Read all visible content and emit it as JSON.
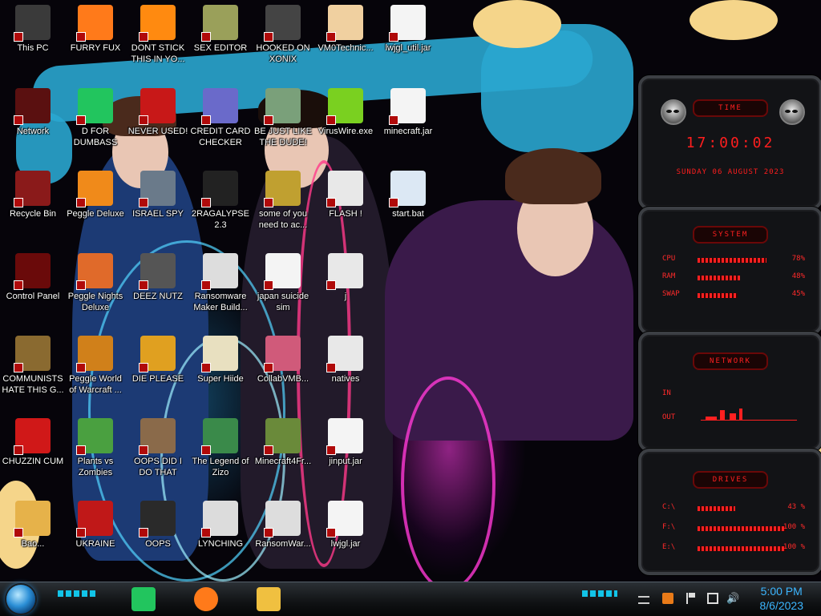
{
  "desktop": {
    "icons": [
      {
        "label": "This PC",
        "icon": "computer-icon",
        "col": 0,
        "row": 0,
        "color": "#3a3a3a"
      },
      {
        "label": "Network",
        "icon": "network-icon",
        "col": 0,
        "row": 1,
        "color": "#5a1010"
      },
      {
        "label": "Recycle Bin",
        "icon": "recycle-bin-icon",
        "col": 0,
        "row": 2,
        "color": "#8a1a1a"
      },
      {
        "label": "Control Panel",
        "icon": "control-panel-icon",
        "col": 0,
        "row": 3,
        "color": "#6a0a0a"
      },
      {
        "label": "COMMUNISTS HATE THIS G...",
        "icon": "money-bag-icon",
        "col": 0,
        "row": 4,
        "color": "#8a6a30"
      },
      {
        "label": "CHUZZIN CUM",
        "icon": "chuzzle-icon",
        "col": 0,
        "row": 5,
        "color": "#d01818"
      },
      {
        "label": "Bao...",
        "icon": "cartoon-icon",
        "col": 0,
        "row": 6,
        "color": "#e6b24a"
      },
      {
        "label": "FURRY FUX",
        "icon": "firefox-icon",
        "col": 1,
        "row": 0,
        "color": "#ff7a1a"
      },
      {
        "label": "D FOR DUMBASS",
        "icon": "chat-icon",
        "col": 1,
        "row": 1,
        "color": "#22c55e"
      },
      {
        "label": "Peggle Deluxe",
        "icon": "peggle-icon",
        "col": 1,
        "row": 2,
        "color": "#f08a1a"
      },
      {
        "label": "Peggle Nights Deluxe",
        "icon": "peggle-icon",
        "col": 1,
        "row": 3,
        "color": "#e06a2a"
      },
      {
        "label": "Peggle World of Warcraft ...",
        "icon": "peggle-icon",
        "col": 1,
        "row": 4,
        "color": "#d0801a"
      },
      {
        "label": "Plants vs Zombies",
        "icon": "plant-icon",
        "col": 1,
        "row": 5,
        "color": "#4aa040"
      },
      {
        "label": "UKRAINE",
        "icon": "radiation-icon",
        "col": 1,
        "row": 6,
        "color": "#c01818"
      },
      {
        "label": "DONT STICK THIS IN YO...",
        "icon": "traffic-cone-icon",
        "col": 2,
        "row": 0,
        "color": "#ff8a10"
      },
      {
        "label": "NEVER USED!",
        "icon": "devcpp-icon",
        "col": 2,
        "row": 1,
        "color": "#c81818"
      },
      {
        "label": "ISRAEL SPY",
        "icon": "computer-icon",
        "col": 2,
        "row": 2,
        "color": "#6a7a8a"
      },
      {
        "label": "DEEZ NUTZ",
        "icon": "windows-stack-icon",
        "col": 2,
        "row": 3,
        "color": "#555555"
      },
      {
        "label": "DIE PLEASE",
        "icon": "de-icon",
        "col": 2,
        "row": 4,
        "color": "#e0a020"
      },
      {
        "label": "OOPS DID I DO THAT",
        "icon": "portrait-icon",
        "col": 2,
        "row": 5,
        "color": "#8a6a4a"
      },
      {
        "label": "OOPS",
        "icon": "monitor-icon",
        "col": 2,
        "row": 6,
        "color": "#2a2a2a"
      },
      {
        "label": "SEX EDITOR",
        "icon": "hxd-icon",
        "col": 3,
        "row": 0,
        "color": "#9aa05a"
      },
      {
        "label": "CREDIT CARD CHECKER",
        "icon": "credit-card-icon",
        "col": 3,
        "row": 1,
        "color": "#6a6aca"
      },
      {
        "label": "2RAGALYPSE 2.3",
        "icon": "terminal-icon",
        "col": 3,
        "row": 2,
        "color": "#222222"
      },
      {
        "label": "Ransomware Maker Build...",
        "icon": "window-icon",
        "col": 3,
        "row": 3,
        "color": "#dddddd"
      },
      {
        "label": "Super Hiide",
        "icon": "pixel-art-icon",
        "col": 3,
        "row": 4,
        "color": "#e8e0c0"
      },
      {
        "label": "The Legend of Zizo",
        "icon": "pixel-hero-icon",
        "col": 3,
        "row": 5,
        "color": "#3a8a4a"
      },
      {
        "label": "LYNCHING",
        "icon": "noose-icon",
        "col": 3,
        "row": 6,
        "color": "#dcdcdc"
      },
      {
        "label": "HOOKED ON XONIX",
        "icon": "xonix-icon",
        "col": 4,
        "row": 0,
        "color": "#444444"
      },
      {
        "label": "BE JUST LIKE THE DUDE!",
        "icon": "elf-icon",
        "col": 4,
        "row": 1,
        "color": "#7aa07a"
      },
      {
        "label": "some of you need to ac...",
        "icon": "beaver-icon",
        "col": 4,
        "row": 2,
        "color": "#c0a030"
      },
      {
        "label": "japan suicide sim",
        "icon": "document-icon",
        "col": 4,
        "row": 3,
        "color": "#f4f4f4"
      },
      {
        "label": "CollabVMB...",
        "icon": "collabvm-icon",
        "col": 4,
        "row": 4,
        "color": "#d05a7a"
      },
      {
        "label": "Minecraft4Fr...",
        "icon": "grass-block-icon",
        "col": 4,
        "row": 5,
        "color": "#6a8a3a"
      },
      {
        "label": "RansomWar...",
        "icon": "skull-icon",
        "col": 4,
        "row": 6,
        "color": "#dddddd"
      },
      {
        "label": "VM0Technic...",
        "icon": "doctor-icon",
        "col": 5,
        "row": 0,
        "color": "#f0d0a0"
      },
      {
        "label": "VirusWire.exe",
        "icon": "lime-icon",
        "col": 5,
        "row": 1,
        "color": "#7ad020"
      },
      {
        "label": "FLASH !",
        "icon": "file-icon",
        "col": 5,
        "row": 2,
        "color": "#e8e8e8"
      },
      {
        "label": "j",
        "icon": "file-icon",
        "col": 5,
        "row": 3,
        "color": "#e8e8e8"
      },
      {
        "label": "natives",
        "icon": "file-icon",
        "col": 5,
        "row": 4,
        "color": "#e8e8e8"
      },
      {
        "label": "jinput.jar",
        "icon": "java-icon",
        "col": 5,
        "row": 5,
        "color": "#f4f4f4"
      },
      {
        "label": "lwjgl.jar",
        "icon": "java-icon",
        "col": 5,
        "row": 6,
        "color": "#f4f4f4"
      },
      {
        "label": "lwjgl_util.jar",
        "icon": "java-icon",
        "col": 6,
        "row": 0,
        "color": "#f4f4f4"
      },
      {
        "label": "minecraft.jar",
        "icon": "java-icon",
        "col": 6,
        "row": 1,
        "color": "#f4f4f4"
      },
      {
        "label": "start.bat",
        "icon": "gear-icon",
        "col": 6,
        "row": 2,
        "color": "#dce8f4"
      }
    ]
  },
  "gadgets": {
    "time": {
      "title": "TIME",
      "time": "17:00:02",
      "date": "SUNDAY 06 AUGUST 2023"
    },
    "system": {
      "title": "SYSTEM",
      "rows": [
        {
          "label": "CPU",
          "value": "78%",
          "level": 0.78
        },
        {
          "label": "RAM",
          "value": "48%",
          "level": 0.48
        },
        {
          "label": "SWAP",
          "value": "45%",
          "level": 0.45
        }
      ]
    },
    "network": {
      "title": "NETWORK",
      "in_label": "IN",
      "out_label": "OUT"
    },
    "drives": {
      "title": "DRIVES",
      "rows": [
        {
          "label": "C:\\",
          "value": "43 %",
          "level": 0.43
        },
        {
          "label": "F:\\",
          "value": "100 %",
          "level": 1.0
        },
        {
          "label": "E:\\",
          "value": "100 %",
          "level": 1.0
        }
      ]
    }
  },
  "taskbar": {
    "start_label": "Start",
    "pinned": [
      {
        "name": "chat-app-icon",
        "color": "#22c55e"
      },
      {
        "name": "firefox-icon",
        "color": "#ff7a1a"
      },
      {
        "name": "file-explorer-icon",
        "color": "#f0c040"
      }
    ],
    "clock": {
      "time": "5:00 PM",
      "date": "8/6/2023"
    }
  }
}
